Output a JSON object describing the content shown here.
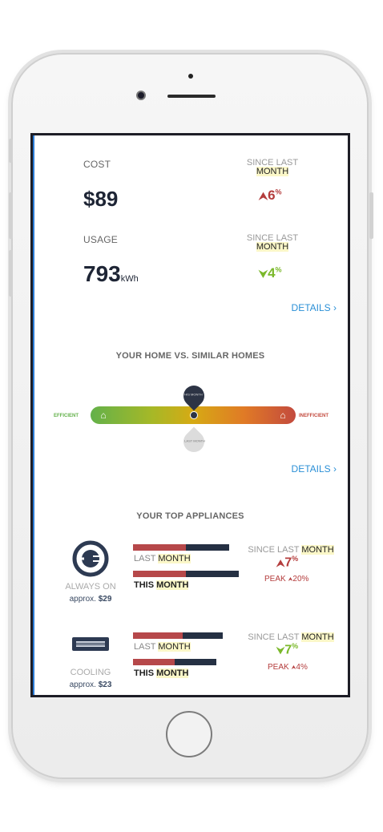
{
  "summary": {
    "cost_label": "COST",
    "cost_value": "$89",
    "cost_since_line1": "SINCE LAST",
    "cost_since_line2": "MONTH",
    "cost_change_arrow": "⮝",
    "cost_change_value": "6",
    "cost_change_unit": "%",
    "usage_label": "USAGE",
    "usage_value": "793",
    "usage_unit": "kWh",
    "usage_since_line1": "SINCE LAST",
    "usage_since_line2": "MONTH",
    "usage_change_arrow": "⮟",
    "usage_change_value": "4",
    "usage_change_unit": "%",
    "details_label": "DETAILS ›"
  },
  "comparison": {
    "title": "YOUR HOME VS. SIMILAR HOMES",
    "left_label": "EFFICIENT",
    "right_label": "INEFFICIENT",
    "this_month_pin": "THIS MONTH",
    "last_month_pin": "LAST MONTH",
    "details_label": "DETAILS ›",
    "colors": {
      "efficient": "#63b14a",
      "inefficient": "#c34a3e"
    }
  },
  "appliances": {
    "title": "YOUR TOP APPLIANCES",
    "items": [
      {
        "name": "ALWAYS ON",
        "approx_label": "approx.",
        "approx_value": "$29",
        "icon": "plug-icon",
        "last_month_fraction": 0.55,
        "this_month_fraction": 0.5,
        "last_label_a": "LAST ",
        "last_label_b": "MONTH",
        "this_label_a": "THIS ",
        "this_label_b": "MONTH",
        "since_a": "SINCE LAST ",
        "since_b": "MONTH",
        "change_arrow": "⮝",
        "change_value": "7",
        "change_unit": "%",
        "peak_label": "PEAK ",
        "peak_value": "20%",
        "peak_arrow": "⮝"
      },
      {
        "name": "COOLING",
        "approx_label": "approx.",
        "approx_value": "$23",
        "icon": "ac-unit-icon",
        "last_month_fraction": 0.55,
        "this_month_fraction": 0.5,
        "last_label_a": "LAST ",
        "last_label_b": "MONTH",
        "this_label_a": "THIS ",
        "this_label_b": "MONTH",
        "since_a": "SINCE LAST ",
        "since_b": "MONTH",
        "change_arrow": "⮟",
        "change_value": "7",
        "change_unit": "%",
        "peak_label": "PEAK ",
        "peak_value": "4%",
        "peak_arrow": "⮝"
      }
    ]
  }
}
